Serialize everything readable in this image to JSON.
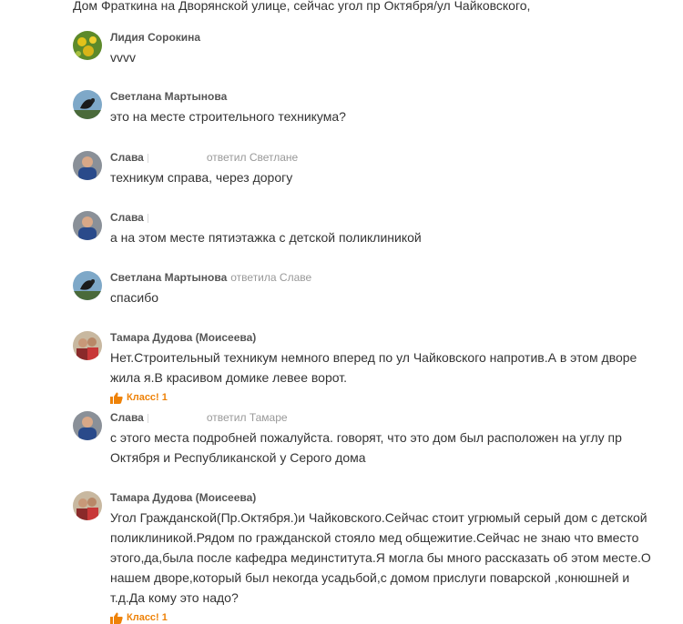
{
  "top_text": "Дом Фраткина на Дворянской улице, сейчас угол пр Октября/ул Чайковского,",
  "like_label": "Класс! 1",
  "comments": [
    {
      "author": "Лидия Сорокина",
      "reply": "",
      "text": "vvvv"
    },
    {
      "author": "Светлана Мартынова",
      "reply": "",
      "text": "это на месте строительного техникума?"
    },
    {
      "author": "Слава",
      "reply": "ответил Светлане",
      "text": "техникум справа, через дорогу"
    },
    {
      "author": "Слава",
      "reply": "",
      "text": "а на этом месте пятиэтажка с детской поликлиникой"
    },
    {
      "author": "Светлана Мартынова",
      "reply": "ответила Славе",
      "text": "спасибо"
    },
    {
      "author": "Тамара Дудова (Моисеева)",
      "reply": "",
      "text": "Нет.Строительный техникум немного вперед по ул Чайковского напротив.А в этом дворе жила я.В красивом домике левее ворот."
    },
    {
      "author": "Слава",
      "reply": "ответил Тамаре",
      "text": "с этого места подробней пожалуйста. говорят, что это дом был расположен на углу пр Октября и Республиканской у Серого дома"
    },
    {
      "author": "Тамара Дудова (Моисеева)",
      "reply": "",
      "text": "Угол Гражданской(Пр.Октября.)и Чайковского.Сейчас стоит угрюмый серый дом с детской поликлиникой.Рядом по гражданской стояло мед общежитие.Сейчас не знаю что вместо этого,да,была после кафедра мединститута.Я могла бы много рассказать об этом месте.О нашем дворе,который был некогда усадьбой,с домом прислуги поварской ,конюшней и т.д.Да кому это надо?"
    }
  ],
  "colors": {
    "accent": "#ee8208",
    "author": "#555555",
    "reply": "#999999"
  }
}
